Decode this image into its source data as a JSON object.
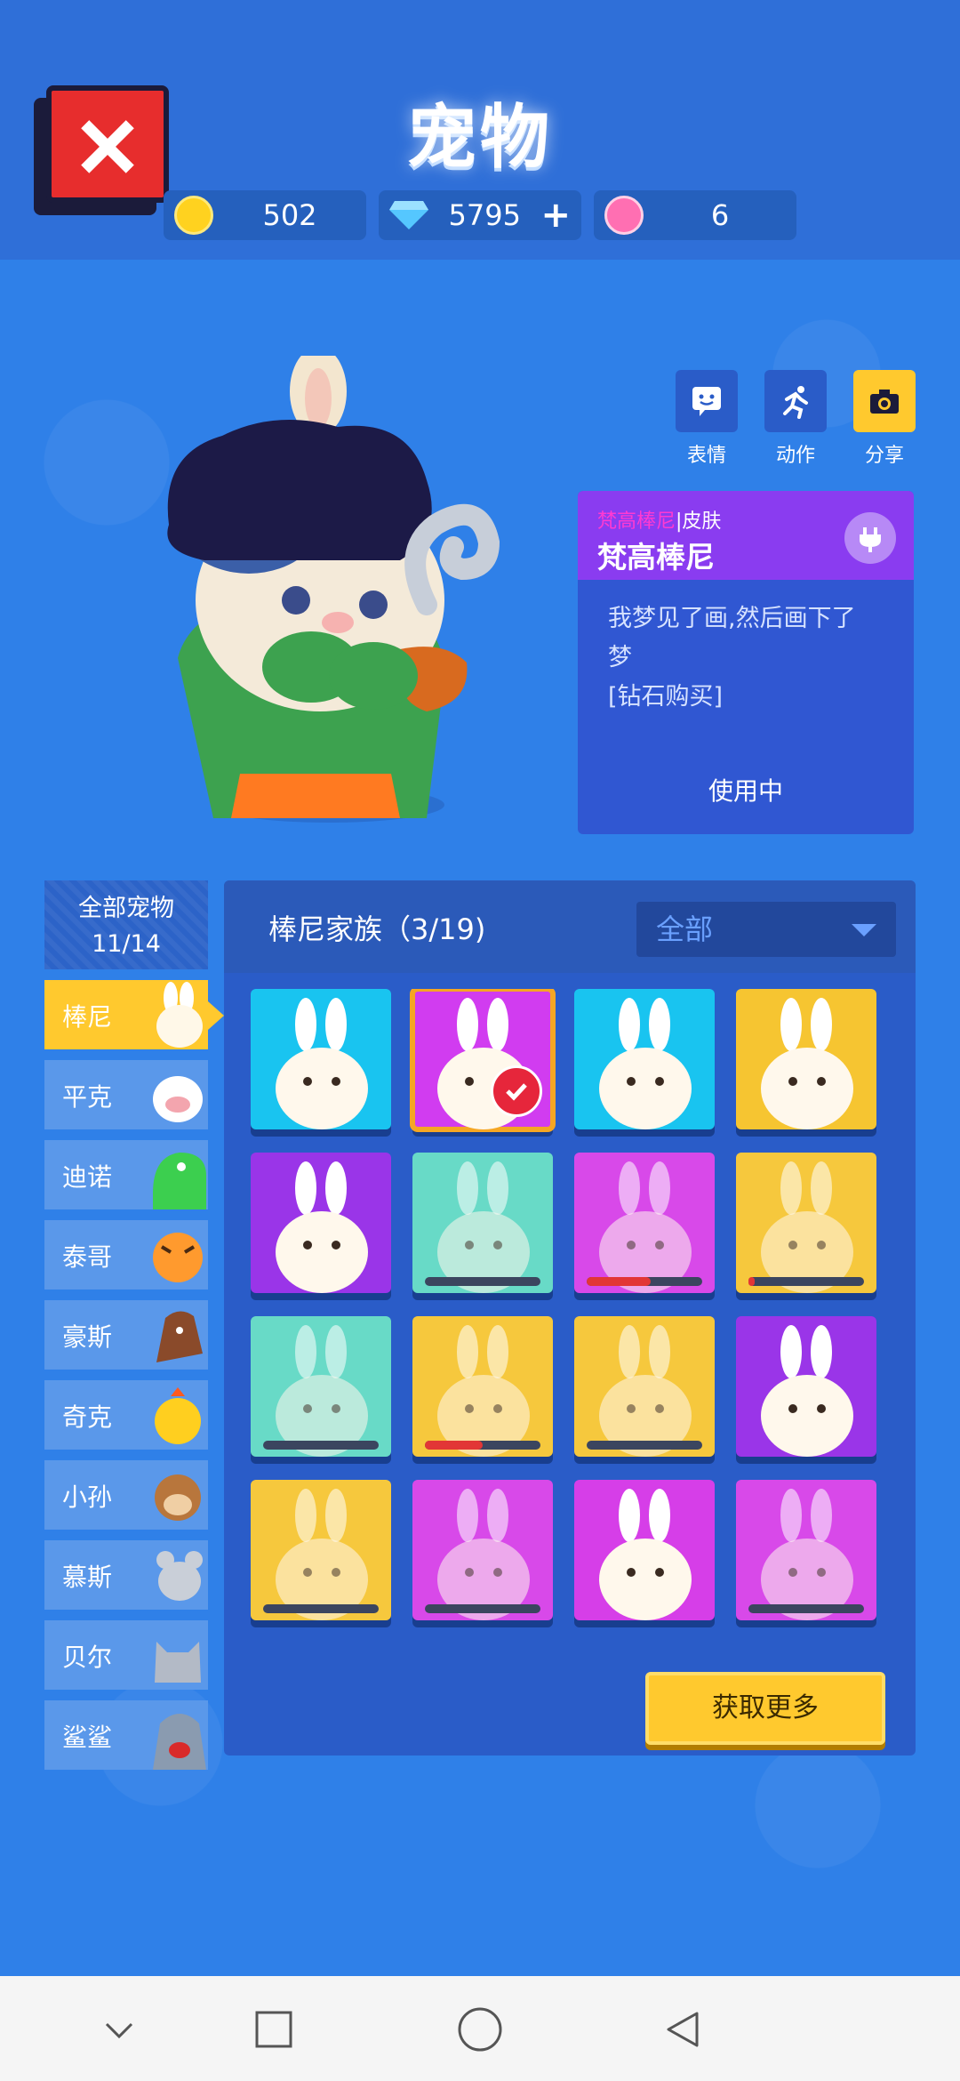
{
  "header": {
    "title": "宠物",
    "currencies": [
      {
        "name": "gold-coin",
        "value": "502",
        "color": "#ffd21f"
      },
      {
        "name": "diamond",
        "value": "5795",
        "color": "#55c7ff"
      },
      {
        "name": "lotus",
        "value": "6",
        "color": "#ff6fb2"
      }
    ]
  },
  "actions": [
    {
      "label": "表情",
      "icon": "emote-icon"
    },
    {
      "label": "动作",
      "icon": "running-icon"
    },
    {
      "label": "分享",
      "icon": "camera-icon"
    }
  ],
  "skin": {
    "rarity": "梵高棒尼",
    "type": "|皮肤",
    "name": "梵高棒尼",
    "description_line1": "我梦见了画,然后画下了",
    "description_line2": "梦",
    "description_line3": "[钻石购买]",
    "status": "使用中"
  },
  "sidebar": {
    "header_line1": "全部宠物",
    "header_line2": "11/14",
    "items": [
      {
        "label": "棒尼",
        "active": true
      },
      {
        "label": "平克"
      },
      {
        "label": "迪诺"
      },
      {
        "label": "泰哥"
      },
      {
        "label": "豪斯"
      },
      {
        "label": "奇克"
      },
      {
        "label": "小孙"
      },
      {
        "label": "慕斯"
      },
      {
        "label": "贝尔"
      },
      {
        "label": "鲨鲨"
      }
    ]
  },
  "family": {
    "title": "棒尼家族（3/19)",
    "filter": "全部",
    "get_more": "获取更多"
  },
  "cards": [
    {
      "bg": "#19c4f0",
      "progress": null
    },
    {
      "bg": "#d13cf0",
      "selected": true,
      "progress": null
    },
    {
      "bg": "#19c4f0",
      "progress": null
    },
    {
      "bg": "#f6c531",
      "progress": null
    },
    {
      "bg": "#9a35e8",
      "progress": null
    },
    {
      "bg": "#5fd8c4",
      "progress": 0
    },
    {
      "bg": "#d63ee8",
      "progress": 0.55
    },
    {
      "bg": "#f6c531",
      "progress": 0.05
    },
    {
      "bg": "#5fd8c4",
      "progress": 0
    },
    {
      "bg": "#f6c531",
      "progress": 0.5
    },
    {
      "bg": "#f6c531",
      "progress": 0
    },
    {
      "bg": "#9a35e8",
      "progress": null
    },
    {
      "bg": "#f6c531",
      "progress": 0
    },
    {
      "bg": "#d63ee8",
      "progress": 0
    },
    {
      "bg": "#d63ee8",
      "progress": null
    },
    {
      "bg": "#d63ee8",
      "progress": 0
    }
  ]
}
